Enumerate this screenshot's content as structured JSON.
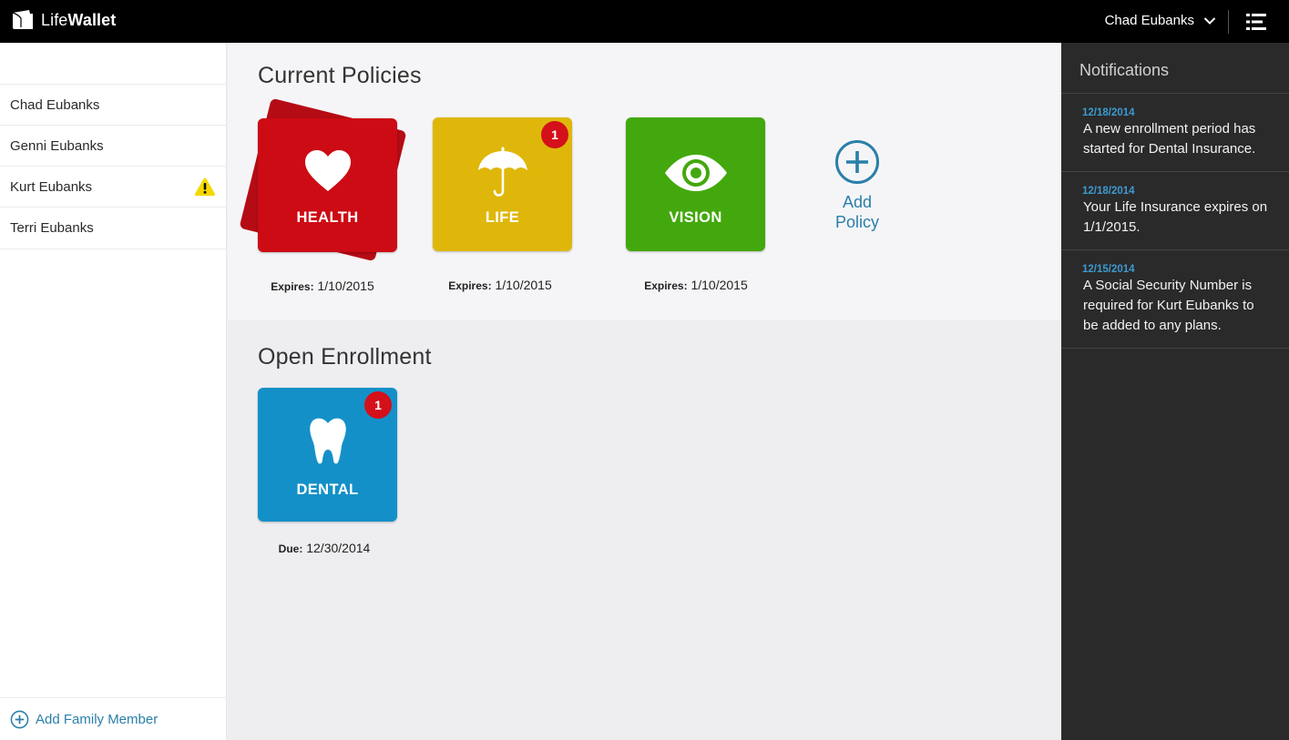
{
  "app": {
    "brand_light": "Life",
    "brand_bold": "Wallet",
    "user_name": "Chad Eubanks"
  },
  "sidebar": {
    "members": [
      {
        "name": "Chad Eubanks",
        "warning": false
      },
      {
        "name": "Genni Eubanks",
        "warning": false
      },
      {
        "name": "Kurt Eubanks",
        "warning": true
      },
      {
        "name": "Terri Eubanks",
        "warning": false
      }
    ],
    "add_member_label": "Add Family Member"
  },
  "policies": {
    "title": "Current Policies",
    "expires_label": "Expires:",
    "items": [
      {
        "label": "HEALTH",
        "expires": "1/10/2015",
        "color": "#cc0b14",
        "icon": "heart-icon",
        "badge": null
      },
      {
        "label": "LIFE",
        "expires": "1/10/2015",
        "color": "#dfb70b",
        "icon": "umbrella-icon",
        "badge": "1"
      },
      {
        "label": "VISION",
        "expires": "1/10/2015",
        "color": "#43a80d",
        "icon": "eye-icon",
        "badge": null
      }
    ],
    "add_policy_line1": "Add",
    "add_policy_line2": "Policy"
  },
  "enrollment": {
    "title": "Open Enrollment",
    "due_label": "Due:",
    "items": [
      {
        "label": "DENTAL",
        "due": "12/30/2014",
        "color": "#1490c8",
        "icon": "tooth-icon",
        "badge": "1"
      }
    ]
  },
  "notifications": {
    "title": "Notifications",
    "items": [
      {
        "date": "12/18/2014",
        "text": "A new enrollment period has started for Dental Insurance."
      },
      {
        "date": "12/18/2014",
        "text": "Your Life Insurance expires on 1/1/2015."
      },
      {
        "date": "12/15/2014",
        "text": "A Social Security Number is required for Kurt Eubanks to be added to any plans."
      }
    ]
  },
  "colors": {
    "accent": "#2a7fa8",
    "badge": "#d4101a",
    "warning": "#f5d800",
    "notif_date": "#3d9ad1"
  }
}
